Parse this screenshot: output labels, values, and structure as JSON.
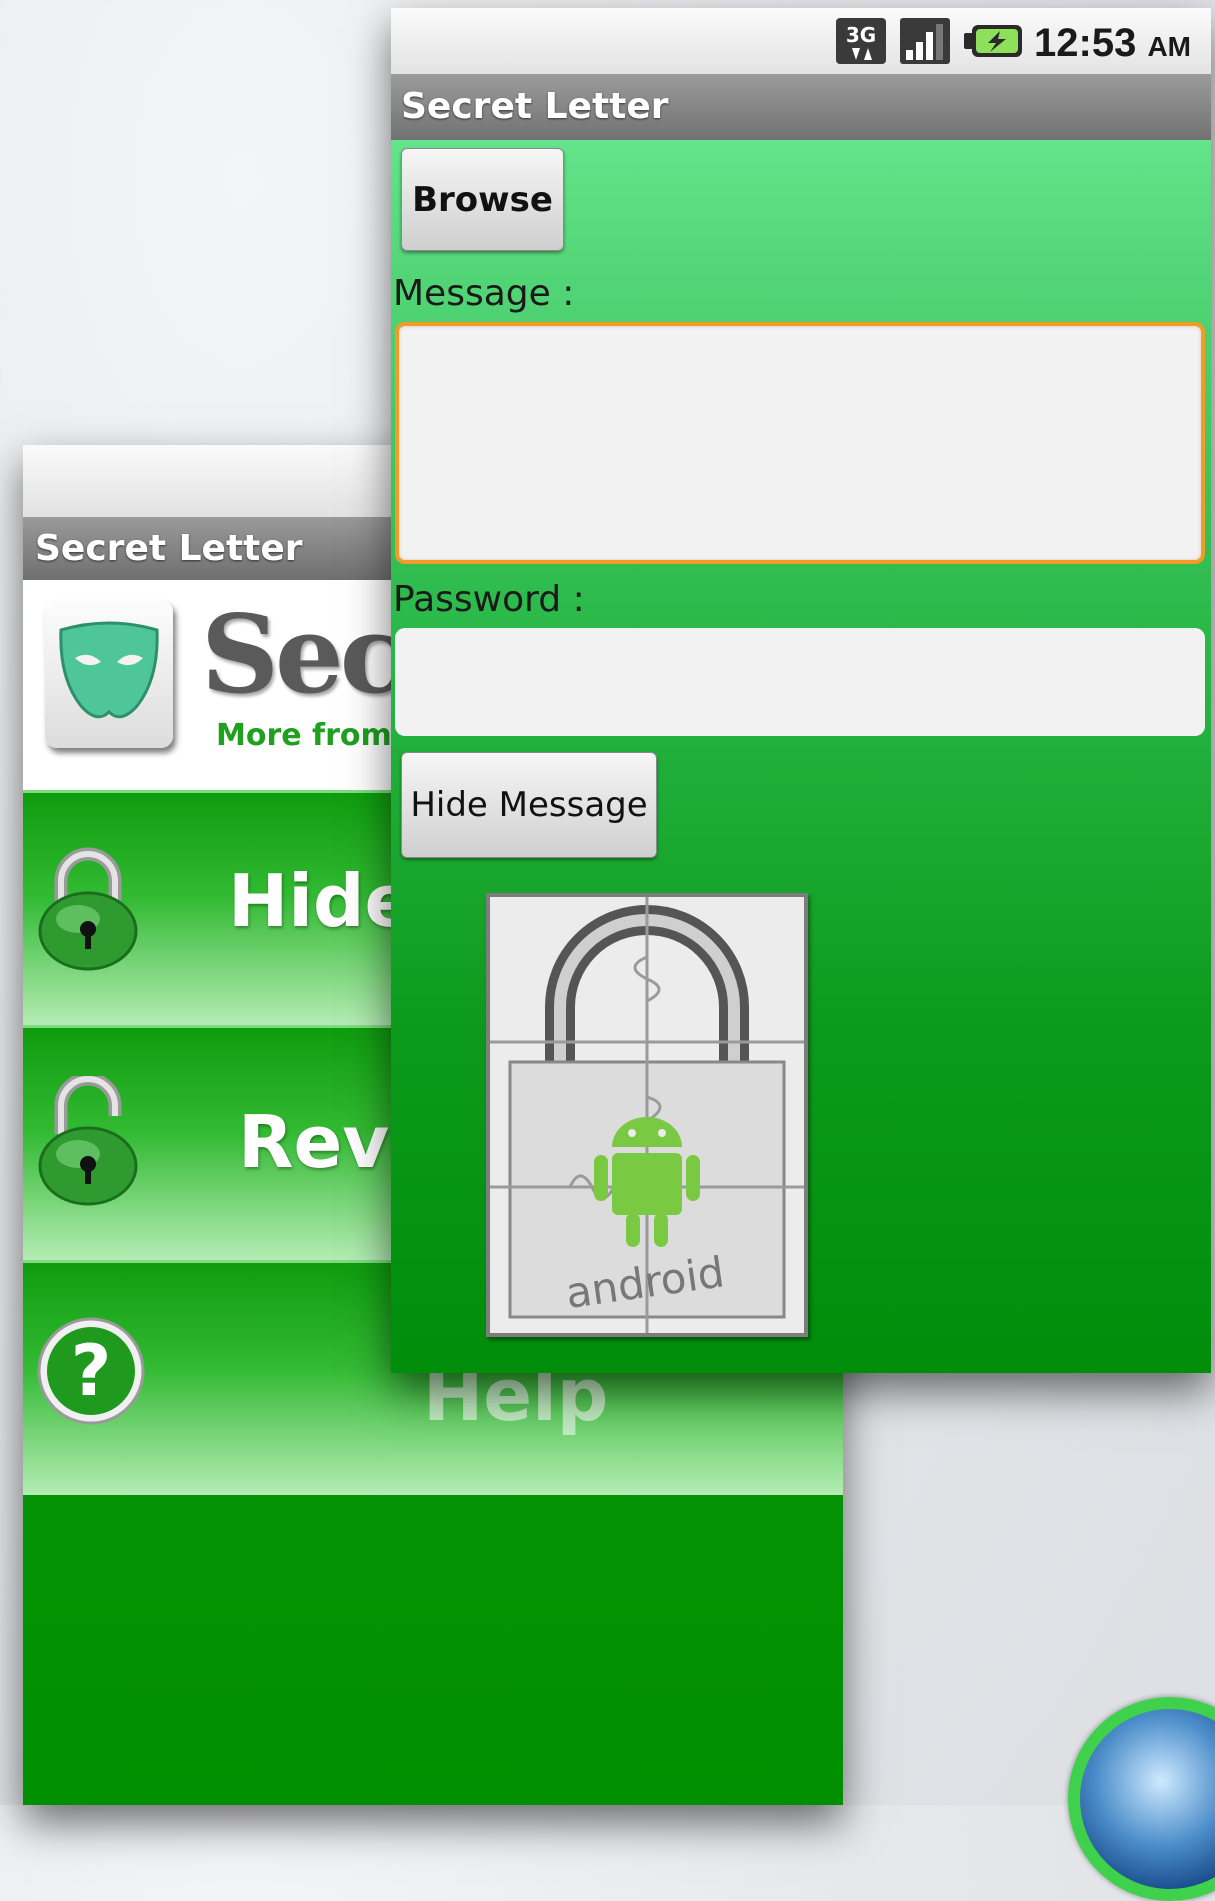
{
  "back_screen": {
    "title": "Secret Letter",
    "brand_text": "Secr",
    "brand_subtext": "More from w",
    "menu": [
      {
        "label": "Hide"
      },
      {
        "label": "Reve"
      },
      {
        "label": "Help"
      }
    ]
  },
  "front_screen": {
    "status_bar": {
      "network": "3G",
      "time": "12:53",
      "ampm": "AM"
    },
    "title": "Secret Letter",
    "browse_label": "Browse",
    "message_label": "Message :",
    "message_value": "",
    "password_label": "Password :",
    "password_value": "",
    "hide_button_label": "Hide Message",
    "image_caption": "android"
  },
  "colors": {
    "accent_green": "#0a9a0a",
    "focus_orange": "#f29b25"
  }
}
